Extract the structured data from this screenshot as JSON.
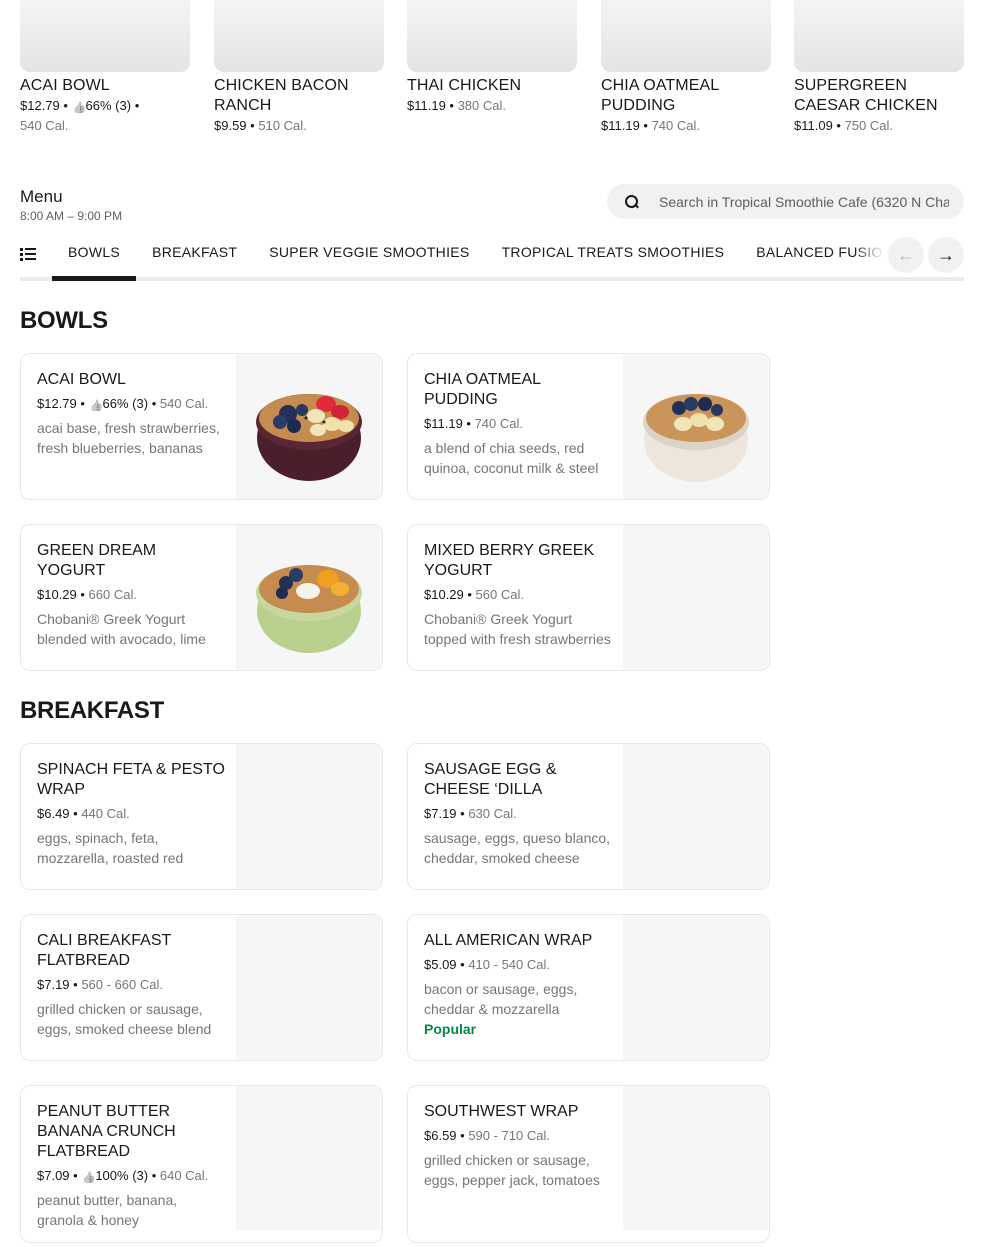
{
  "featured": [
    {
      "name": "ACAI BOWL",
      "price": "$12.79",
      "rating": "66% (3)",
      "calories": "540 Cal."
    },
    {
      "name": "CHICKEN BACON RANCH",
      "price": "$9.59",
      "rating": "",
      "calories": "510 Cal."
    },
    {
      "name": "THAI CHICKEN",
      "price": "$11.19",
      "rating": "",
      "calories": "380 Cal."
    },
    {
      "name": "CHIA OATMEAL PUDDING",
      "price": "$11.19",
      "rating": "",
      "calories": "740 Cal."
    },
    {
      "name": "SUPERGREEN CAESAR CHICKEN",
      "price": "$11.09",
      "rating": "",
      "calories": "750 Cal."
    }
  ],
  "menu": {
    "title": "Menu",
    "hours": "8:00 AM – 9:00 PM",
    "search_placeholder": "Search in Tropical Smoothie Cafe (6320 N Cha"
  },
  "tabs": [
    "BOWLS",
    "BREAKFAST",
    "SUPER VEGGIE SMOOTHIES",
    "TROPICAL TREATS SMOOTHIES",
    "BALANCED FUSION SMOOTHIES"
  ],
  "active_tab": "BOWLS",
  "icons": {
    "prev": "arrow-left-icon",
    "next": "arrow-right-icon",
    "list": "list-icon",
    "search": "search-icon",
    "like": "thumbs-up-icon"
  },
  "colors": {
    "popular": "#048848",
    "text": "#191919",
    "muted": "#767676"
  },
  "sections": [
    {
      "title": "BOWLS",
      "items": [
        {
          "name": "ACAI BOWL",
          "price": "$12.79",
          "rating": "66% (3)",
          "calories": "540 Cal.",
          "description": "acai base, fresh strawberries, fresh blueberries, bananas",
          "bowl": "acai"
        },
        {
          "name": "CHIA OATMEAL PUDDING",
          "price": "$11.19",
          "rating": "",
          "calories": "740 Cal.",
          "description": "a blend of chia seeds, red quinoa, coconut milk & steel cut oats",
          "bowl": "chia"
        },
        {
          "name": "GREEN DREAM YOGURT",
          "price": "$10.29",
          "rating": "",
          "calories": "660 Cal.",
          "description": "Chobani® Greek Yogurt blended with avocado, lime juice",
          "bowl": "green"
        },
        {
          "name": "MIXED BERRY GREEK YOGURT",
          "price": "$10.29",
          "rating": "",
          "calories": "560 Cal.",
          "description": "Chobani® Greek Yogurt topped with fresh strawberries",
          "bowl": ""
        }
      ]
    },
    {
      "title": "BREAKFAST",
      "items": [
        {
          "name": "SPINACH FETA & PESTO WRAP",
          "price": "$6.49",
          "rating": "",
          "calories": "440 Cal.",
          "description": "eggs, spinach, feta, mozzarella, roasted red peppers"
        },
        {
          "name": "SAUSAGE EGG & CHEESE ‘DILLA",
          "price": "$7.19",
          "rating": "",
          "calories": "630 Cal.",
          "description": "sausage, eggs, queso blanco, cheddar, smoked cheese"
        },
        {
          "name": "CALI BREAKFAST FLATBREAD",
          "price": "$7.19",
          "rating": "",
          "calories": "560 - 660 Cal.",
          "description": "grilled chicken or sausage, eggs, smoked cheese blend"
        },
        {
          "name": "ALL AMERICAN WRAP",
          "price": "$5.09",
          "rating": "",
          "calories": "410 - 540 Cal.",
          "description": "bacon or sausage, eggs, cheddar & mozzarella",
          "badge": "Popular"
        },
        {
          "name": "PEANUT BUTTER BANANA CRUNCH FLATBREAD",
          "price": "$7.09",
          "rating": "100% (3)",
          "calories": "640 Cal.",
          "description": "peanut butter, banana, granola & honey"
        },
        {
          "name": "SOUTHWEST WRAP",
          "price": "$6.59",
          "rating": "",
          "calories": "590 - 710 Cal.",
          "description": "grilled chicken or sausage, eggs, pepper jack, tomatoes"
        }
      ]
    }
  ]
}
